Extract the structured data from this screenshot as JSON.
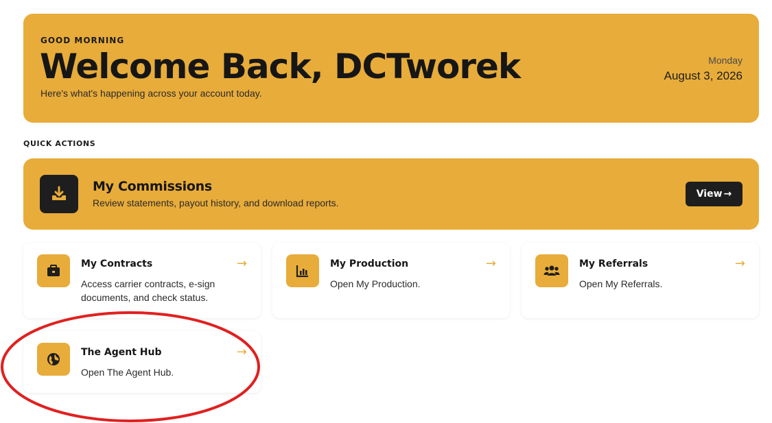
{
  "hero": {
    "greeting": "GOOD MORNING",
    "title": "Welcome Back, DCTworek",
    "subtitle": "Here's what's happening across your account today.",
    "day": "Monday",
    "date": "August 3, 2026"
  },
  "quick_actions": {
    "label": "QUICK ACTIONS",
    "commissions": {
      "icon": "download-tray-icon",
      "title": "My Commissions",
      "description": "Review statements, payout history, and download reports.",
      "button_label": "View",
      "button_arrow": "→"
    },
    "cards": [
      {
        "icon": "briefcase-icon",
        "title": "My Contracts",
        "description": "Access carrier contracts, e-sign documents, and check status.",
        "arrow": "→"
      },
      {
        "icon": "bar-chart-icon",
        "title": "My Production",
        "description": "Open My Production.",
        "arrow": "→"
      },
      {
        "icon": "users-icon",
        "title": "My Referrals",
        "description": "Open My Referrals.",
        "arrow": "→"
      },
      {
        "icon": "globe-icon",
        "title": "The Agent Hub",
        "description": "Open The Agent Hub.",
        "arrow": "→"
      }
    ]
  },
  "colors": {
    "accent": "#e8ac3a",
    "dark": "#1e1e1e",
    "annotation": "#e02020"
  }
}
